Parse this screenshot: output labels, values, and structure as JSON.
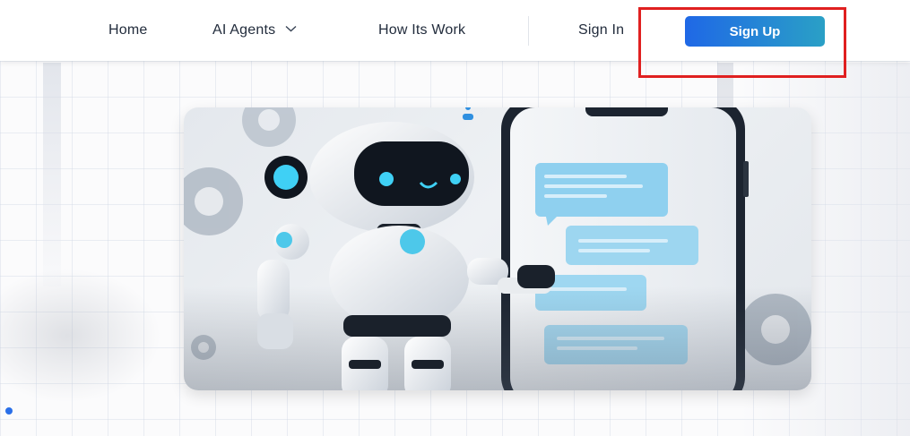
{
  "header": {
    "nav": {
      "home": "Home",
      "ai_agents": "AI Agents",
      "how_it_works": "How Its Work",
      "sign_in": "Sign In"
    },
    "sign_up_label": "Sign Up",
    "icons": {
      "dropdown": "chevron-down-icon"
    }
  },
  "hero": {
    "image": "robot-assistant-chat-illustration"
  },
  "colors": {
    "sign_up_gradient_start": "#1f68e6",
    "sign_up_gradient_end": "#2aa0c6",
    "highlight": "#e02020",
    "nav_text": "#222c3c"
  }
}
